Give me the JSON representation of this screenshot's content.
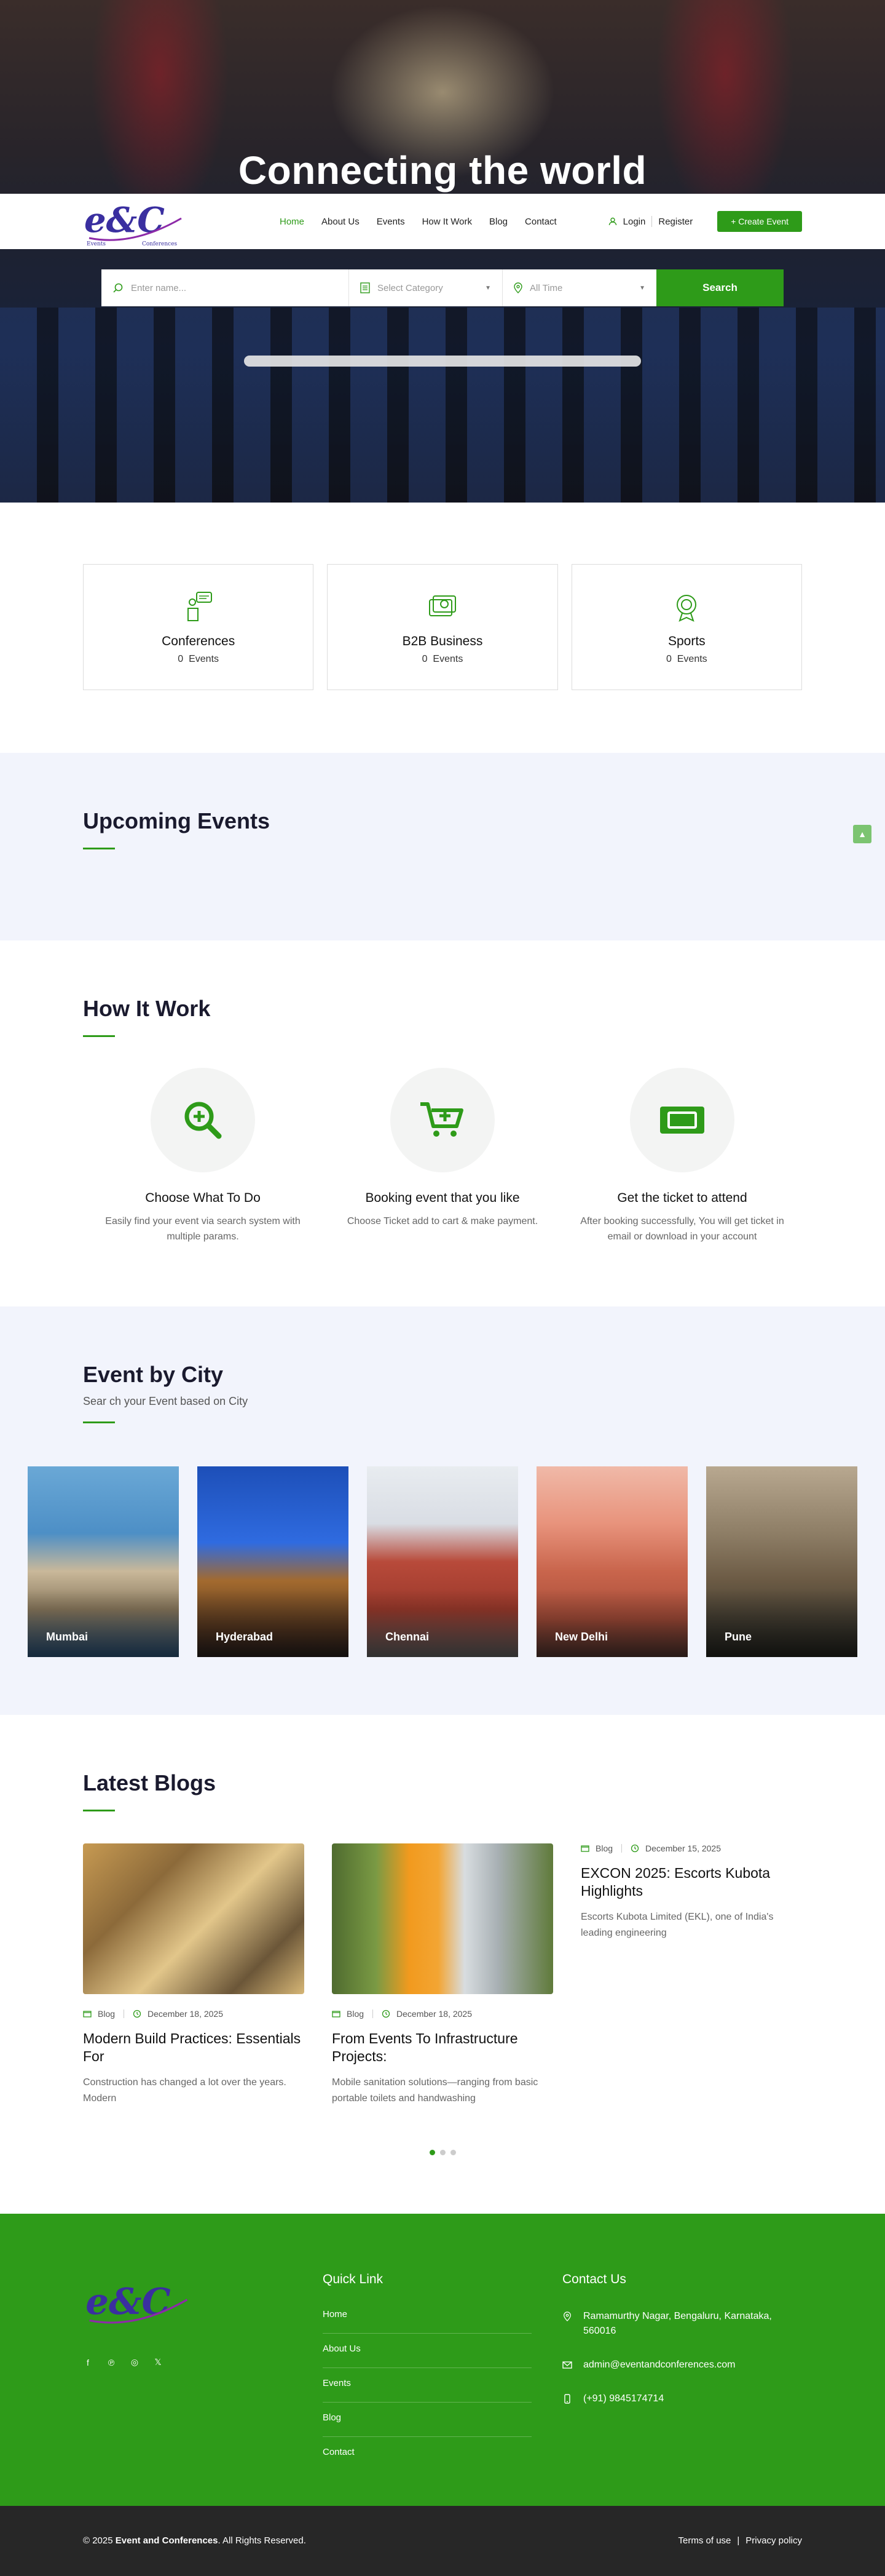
{
  "hero": {
    "title": "Connecting the world"
  },
  "nav": {
    "logo_text": "e&C",
    "logo_tag_left": "Events",
    "logo_tag_right": "Conferences",
    "items": [
      {
        "label": "Home",
        "active": true
      },
      {
        "label": "About Us"
      },
      {
        "label": "Events"
      },
      {
        "label": "How It Work"
      },
      {
        "label": "Blog"
      },
      {
        "label": "Contact"
      }
    ],
    "login": "Login",
    "register": "Register",
    "create": "+ Create Event"
  },
  "search": {
    "name_placeholder": "Enter name...",
    "category": "Select Category",
    "time": "All Time",
    "button": "Search"
  },
  "categories": [
    {
      "title": "Conferences",
      "count": "0",
      "unit": "Events",
      "icon": "conference-icon"
    },
    {
      "title": "B2B Business",
      "count": "0",
      "unit": "Events",
      "icon": "business-icon"
    },
    {
      "title": "Sports",
      "count": "0",
      "unit": "Events",
      "icon": "sports-icon"
    }
  ],
  "upcoming": {
    "title": "Upcoming Events"
  },
  "how": {
    "title": "How It Work",
    "items": [
      {
        "title": "Choose What To Do",
        "text": "Easily find your event via search system with multiple params.",
        "icon": "search-plus-icon"
      },
      {
        "title": "Booking event that you like",
        "text": "Choose Ticket add to cart & make payment.",
        "icon": "cart-plus-icon"
      },
      {
        "title": "Get the ticket to attend",
        "text": "After booking successfully, You will get ticket in email or download in your account",
        "icon": "ticket-icon"
      }
    ]
  },
  "city": {
    "title": "Event by City",
    "subtitle": "Sear ch your Event based on City",
    "items": [
      "Mumbai",
      "Hyderabad",
      "Chennai",
      "New Delhi",
      "Pune"
    ]
  },
  "blogs": {
    "title": "Latest Blogs",
    "items": [
      {
        "category": "Blog",
        "date": "December 18, 2025",
        "title": "Modern Build Practices: Essentials For",
        "excerpt": "Construction has changed a lot over the years. Modern"
      },
      {
        "category": "Blog",
        "date": "December 18, 2025",
        "title": "From Events To Infrastructure Projects:",
        "excerpt": "Mobile sanitation solutions—ranging from basic portable toilets and handwashing"
      },
      {
        "category": "Blog",
        "date": "December 15, 2025",
        "title": "EXCON 2025: Escorts Kubota Highlights",
        "excerpt": "Escorts Kubota Limited (EKL), one of India's leading engineering"
      }
    ]
  },
  "footer": {
    "quick_title": "Quick Link",
    "links": [
      "Home",
      "About Us",
      "Events",
      "Blog",
      "Contact"
    ],
    "contact_title": "Contact Us",
    "address": "Ramamurthy Nagar, Bengaluru, Karnataka, 560016",
    "email": "admin@eventandconferences.com",
    "phone": "(+91) 9845174714"
  },
  "bottom": {
    "copy_prefix": "© 2025",
    "brand": "Event and Conferences",
    "copy_suffix": ". All Rights Reserved.",
    "terms": "Terms of use",
    "sep": "|",
    "privacy": "Privacy policy"
  },
  "colors": {
    "accent": "#2e9b19",
    "footer_bottom": "#272727",
    "soft_bg": "#f2f4fc"
  }
}
